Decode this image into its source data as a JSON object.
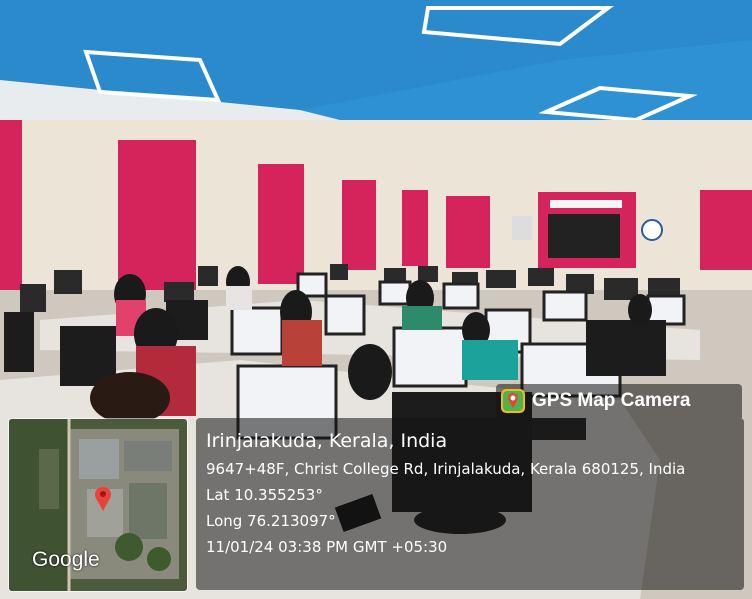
{
  "badge": {
    "title": "GPS Map Camera",
    "icon": "gps-map-camera-icon"
  },
  "location": {
    "place": "Irinjalakuda, Kerala, India",
    "address": "9647+48F, Christ College Rd, Irinjalakuda, Kerala 680125, India",
    "lat": "Lat 10.355253°",
    "long": "Long 76.213097°",
    "datetime": "11/01/24 03:38 PM GMT +05:30"
  },
  "map": {
    "provider": "Google"
  },
  "colors": {
    "ceiling": "#2a8fd0",
    "wall_accent": "#d5235b",
    "overlay": "#141414"
  }
}
